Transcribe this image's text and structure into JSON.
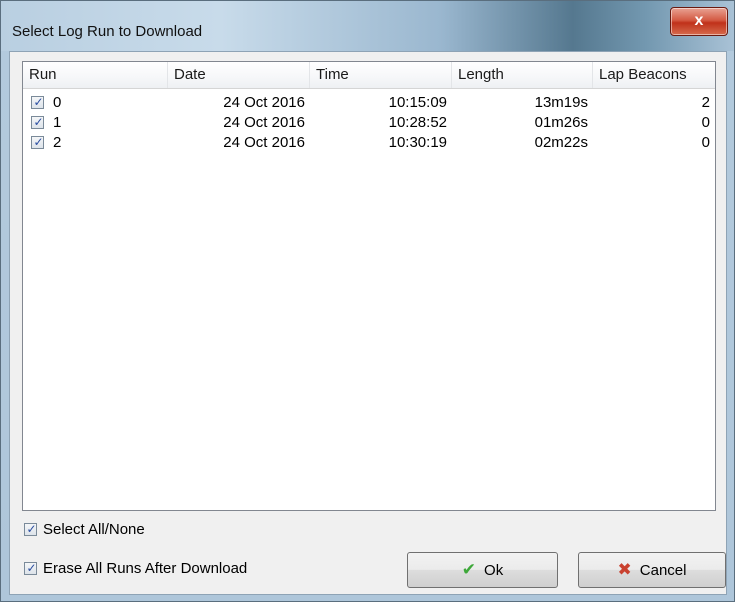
{
  "window": {
    "title": "Select Log Run to Download",
    "close_glyph": "x"
  },
  "table": {
    "columns": [
      "Run",
      "Date",
      "Time",
      "Length",
      "Lap Beacons"
    ],
    "rows": [
      {
        "checked": true,
        "run": "0",
        "date": "24 Oct 2016",
        "time": "10:15:09",
        "length": "13m19s",
        "lap_beacons": "2"
      },
      {
        "checked": true,
        "run": "1",
        "date": "24 Oct 2016",
        "time": "10:28:52",
        "length": "01m26s",
        "lap_beacons": "0"
      },
      {
        "checked": true,
        "run": "2",
        "date": "24 Oct 2016",
        "time": "10:30:19",
        "length": "02m22s",
        "lap_beacons": "0"
      }
    ]
  },
  "options": {
    "select_all_label": "Select All/None",
    "select_all_checked": true,
    "erase_label": "Erase All Runs After Download",
    "erase_checked": true
  },
  "buttons": {
    "ok_label": "Ok",
    "ok_icon": "checkmark-icon",
    "cancel_label": "Cancel",
    "cancel_icon": "cross-icon"
  },
  "colors": {
    "ok_icon": "#3ea83a",
    "cancel_icon": "#c9412f",
    "check": "#2a4da0"
  }
}
